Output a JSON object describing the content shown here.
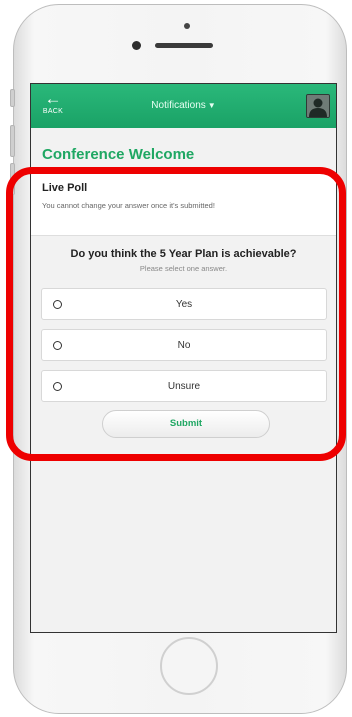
{
  "app": {
    "back_label": "BACK",
    "nav_title": "Notifications",
    "nav_caret": "▼",
    "back_icon": "←"
  },
  "page": {
    "title": "Conference Welcome"
  },
  "poll": {
    "heading": "Live Poll",
    "note": "You cannot change your answer once it's submitted!",
    "question": "Do you think the 5 Year Plan is achievable?",
    "instruction": "Please select one answer.",
    "options": [
      {
        "label": "Yes"
      },
      {
        "label": "No"
      },
      {
        "label": "Unsure"
      }
    ],
    "submit_label": "Submit"
  },
  "colors": {
    "accent": "#1fa763",
    "annotation": "#ee0000",
    "topbar": "#1aa266"
  }
}
